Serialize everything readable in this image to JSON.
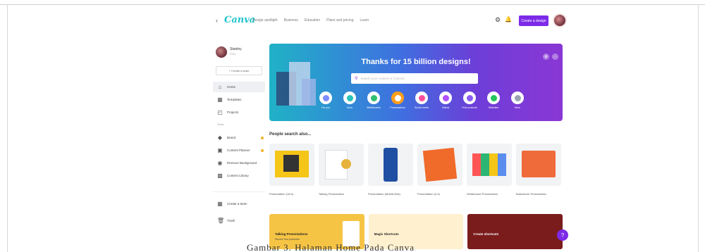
{
  "app": {
    "logo": "Canva",
    "nav_links": [
      "Design spotlight",
      "Business",
      "Education",
      "Plans and pricing",
      "Learn"
    ],
    "create_button": "Create a design"
  },
  "sidebar": {
    "user_name": "Stanley",
    "user_plan": "Free",
    "top_button": "+ Create a team",
    "items": [
      {
        "label": "Home",
        "icon": "home-icon"
      },
      {
        "label": "Templates",
        "icon": "templates-icon"
      },
      {
        "label": "Projects",
        "icon": "projects-icon"
      }
    ],
    "section_label": "Tools",
    "tool_items": [
      {
        "label": "Brand",
        "icon": "brand-icon"
      },
      {
        "label": "Content Planner",
        "icon": "planner-icon"
      },
      {
        "label": "Remove Background",
        "icon": "remove-bg-icon"
      },
      {
        "label": "Content Library",
        "icon": "library-icon"
      }
    ],
    "bottom_items": [
      {
        "label": "Create a team",
        "icon": "team-icon"
      },
      {
        "label": "Trash",
        "icon": "trash-icon"
      }
    ]
  },
  "hero": {
    "title": "Thanks for 15 billion designs!",
    "search_placeholder": "Search your content or Canva's",
    "categories": [
      {
        "label": "For you",
        "color": "#7d8cff"
      },
      {
        "label": "Docs",
        "color": "#27c4b8"
      },
      {
        "label": "Whiteboards",
        "color": "#2fbf71"
      },
      {
        "label": "Presentations",
        "color": "#ff9f1a"
      },
      {
        "label": "Social media",
        "color": "#ff4f9a"
      },
      {
        "label": "Videos",
        "color": "#b14fff"
      },
      {
        "label": "Print products",
        "color": "#8b5cf6"
      },
      {
        "label": "Websites",
        "color": "#22c55e"
      },
      {
        "label": "More",
        "color": "#9aa3b2"
      }
    ]
  },
  "section": {
    "title": "People search also...",
    "tiles": [
      {
        "label": "Presentation (16:9)",
        "accent": "#f5c518"
      },
      {
        "label": "Talking Presentation",
        "accent": "#e7b23b"
      },
      {
        "label": "Presentation (Mobile-first)",
        "accent": "#1f4fa3"
      },
      {
        "label": "Presentation (4:3)",
        "accent": "#f06a2a"
      },
      {
        "label": "Whiteboard Presentation",
        "accent": "#2bb673"
      },
      {
        "label": "Brainstorm Presentation",
        "accent": "#ef6b3a"
      }
    ]
  },
  "bottom_cards": [
    {
      "title": "Talking Presentations",
      "subtitle": "Record Your presenter",
      "bg": "#f6c445"
    },
    {
      "title": "Magic Shortcuts",
      "subtitle": "",
      "bg": "#fff1cf"
    },
    {
      "title": "Create shortcuts",
      "subtitle": "",
      "bg": "#7a1c1c"
    }
  ],
  "help_button": "?",
  "caption": "Gambar 3. Halaman Home Pada Canva"
}
